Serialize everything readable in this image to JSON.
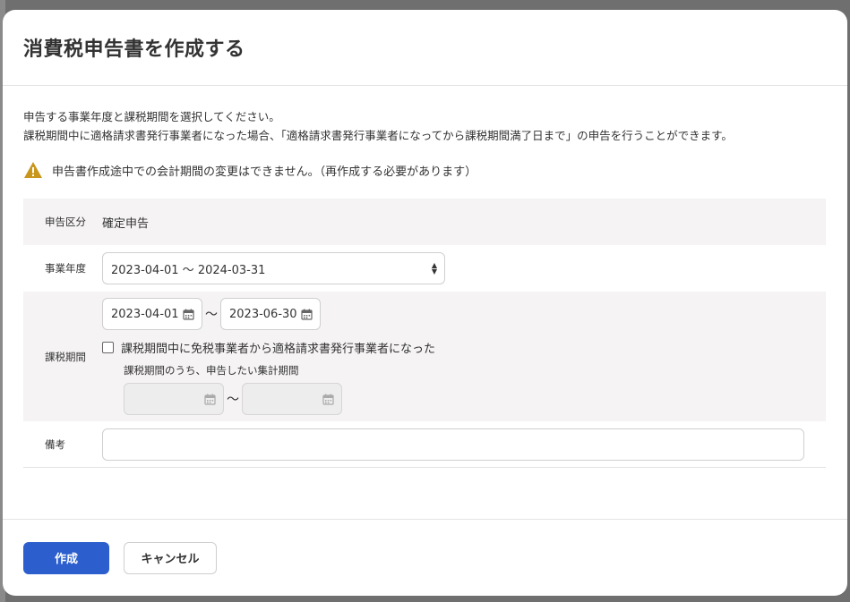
{
  "modal": {
    "title": "消費税申告書を作成する",
    "description": [
      "申告する事業年度と課税期間を選択してください。",
      "課税期間中に適格請求書発行事業者になった場合、「適格請求書発行事業者になってから課税期間満了日まで」の申告を行うことができます。"
    ],
    "warning": "申告書作成途中での会計期間の変更はできません。（再作成する必要があります）"
  },
  "form": {
    "filing_type": {
      "label": "申告区分",
      "value": "確定申告"
    },
    "fiscal_year": {
      "label": "事業年度",
      "selected": "2023-04-01 ～ 2024-03-31"
    },
    "tax_period": {
      "label": "課税期間",
      "start": "2023-04-01",
      "separator": "～",
      "end": "2023-06-30",
      "checkbox_label": "課税期間中に免税事業者から適格請求書発行事業者になった",
      "sub_label": "課税期間のうち、申告したい集計期間",
      "sub_start": "",
      "sub_end": ""
    },
    "notes": {
      "label": "備考",
      "value": ""
    }
  },
  "footer": {
    "create_label": "作成",
    "cancel_label": "キャンセル"
  },
  "colors": {
    "primary": "#2c5fcd",
    "warning": "#c8961c",
    "row_shade": "#f5f3f3"
  },
  "icons": {
    "warning": "warning-triangle-icon",
    "calendar": "calendar-icon",
    "select": "select-arrows-icon"
  }
}
